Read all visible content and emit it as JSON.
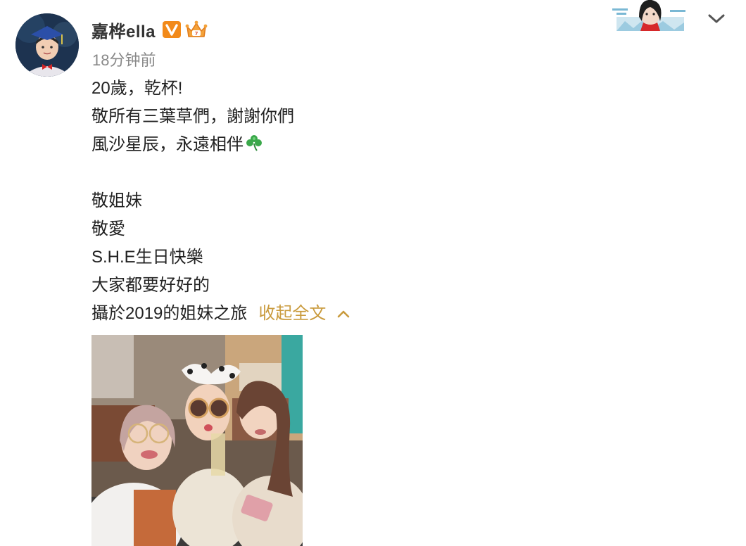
{
  "post": {
    "author": {
      "name": "嘉桦ella",
      "avatar": "avatar-graduation-child",
      "verified_icon": "verified-v-icon",
      "member_icon": "crown-member-icon"
    },
    "timestamp": "18分钟前",
    "text_lines": [
      "20歲，乾杯!",
      "敬所有三葉草們，謝謝你們",
      "風沙星辰，永遠相伴",
      "",
      "敬姐妹",
      "敬愛",
      "S.H.E生日快樂",
      "大家都要好好的",
      "攝於2019的姐妹之旅"
    ],
    "emoji": "shamrock-icon",
    "collapse_label": "收起全文",
    "collapse_icon": "chevron-up-icon",
    "photo": "photo-three-women-restaurant",
    "menu_icon": "chevron-down-icon",
    "header_decoration": "card-decoration-woman-illustration"
  },
  "colors": {
    "text": "#222222",
    "username": "#333333",
    "timestamp": "#888888",
    "link": "#c99a3c",
    "verified_badge": "#f28a1a"
  }
}
